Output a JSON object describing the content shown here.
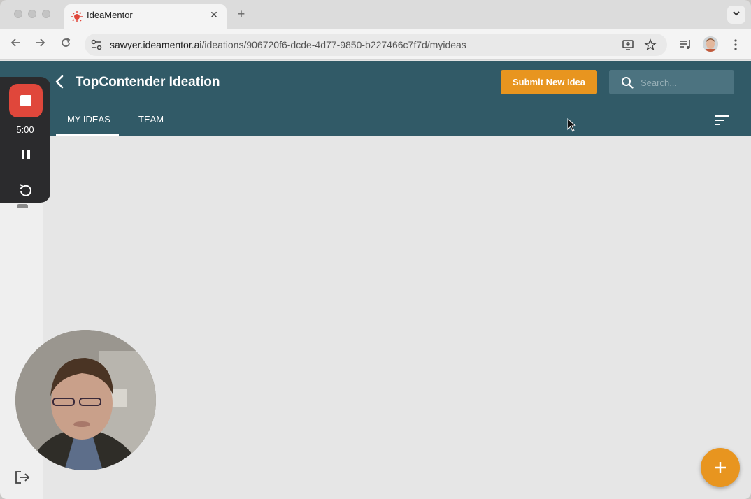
{
  "browser": {
    "tab_title": "IdeaMentor",
    "close_label": "✕",
    "new_tab_label": "+",
    "url_host": "sawyer.ideamentor.ai",
    "url_path": "/ideations/906720f6-dcde-4d77-9850-b227466c7f7d/myideas"
  },
  "app": {
    "title": "TopContender Ideation",
    "submit_label": "Submit New Idea",
    "search_placeholder": "Search...",
    "tabs": [
      {
        "label": "MY IDEAS",
        "active": true
      },
      {
        "label": "TEAM",
        "active": false
      }
    ],
    "accent_color": "#e8951f",
    "header_color": "#315a67"
  },
  "recorder": {
    "time": "5:00",
    "stop_color": "#e0473b"
  }
}
